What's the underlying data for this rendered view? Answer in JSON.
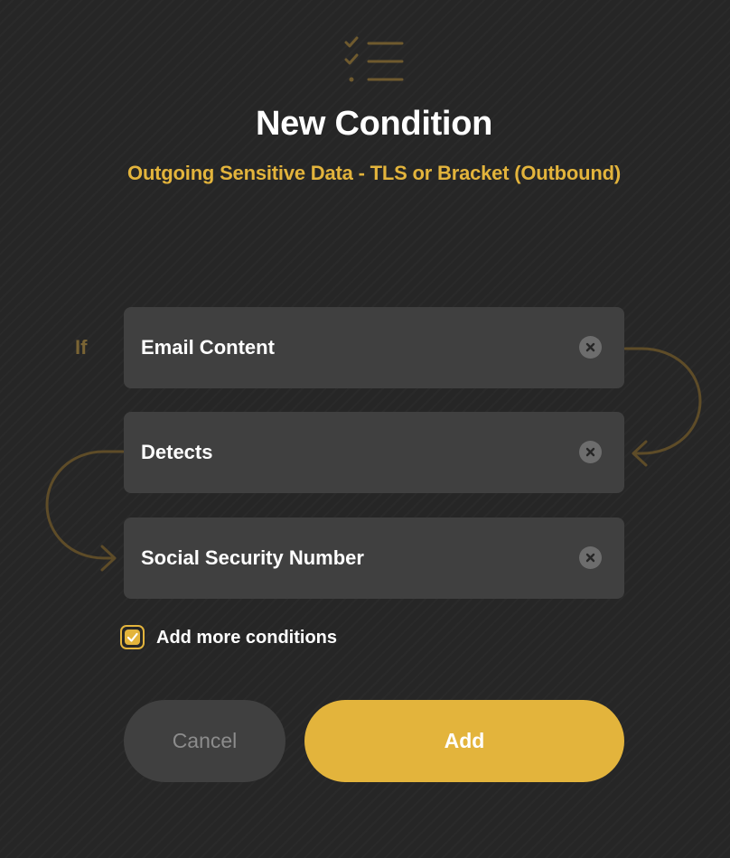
{
  "dialog": {
    "icon": "checklist-icon",
    "title": "New Condition",
    "subtitle": "Outgoing Sensitive Data - TLS or Bracket (Outbound)"
  },
  "condition": {
    "if_label": "If",
    "fields": [
      {
        "value": "Email Content",
        "clear_icon": "clear-icon"
      },
      {
        "value": "Detects",
        "clear_icon": "clear-icon"
      },
      {
        "value": "Social Security Number",
        "clear_icon": "clear-icon"
      }
    ]
  },
  "options": {
    "add_more_label": "Add more conditions",
    "add_more_checked": true
  },
  "actions": {
    "cancel_label": "Cancel",
    "add_label": "Add"
  },
  "colors": {
    "accent": "#e3b43c",
    "background": "#262626",
    "field_bg": "#404040",
    "connector": "#5e4c28"
  }
}
